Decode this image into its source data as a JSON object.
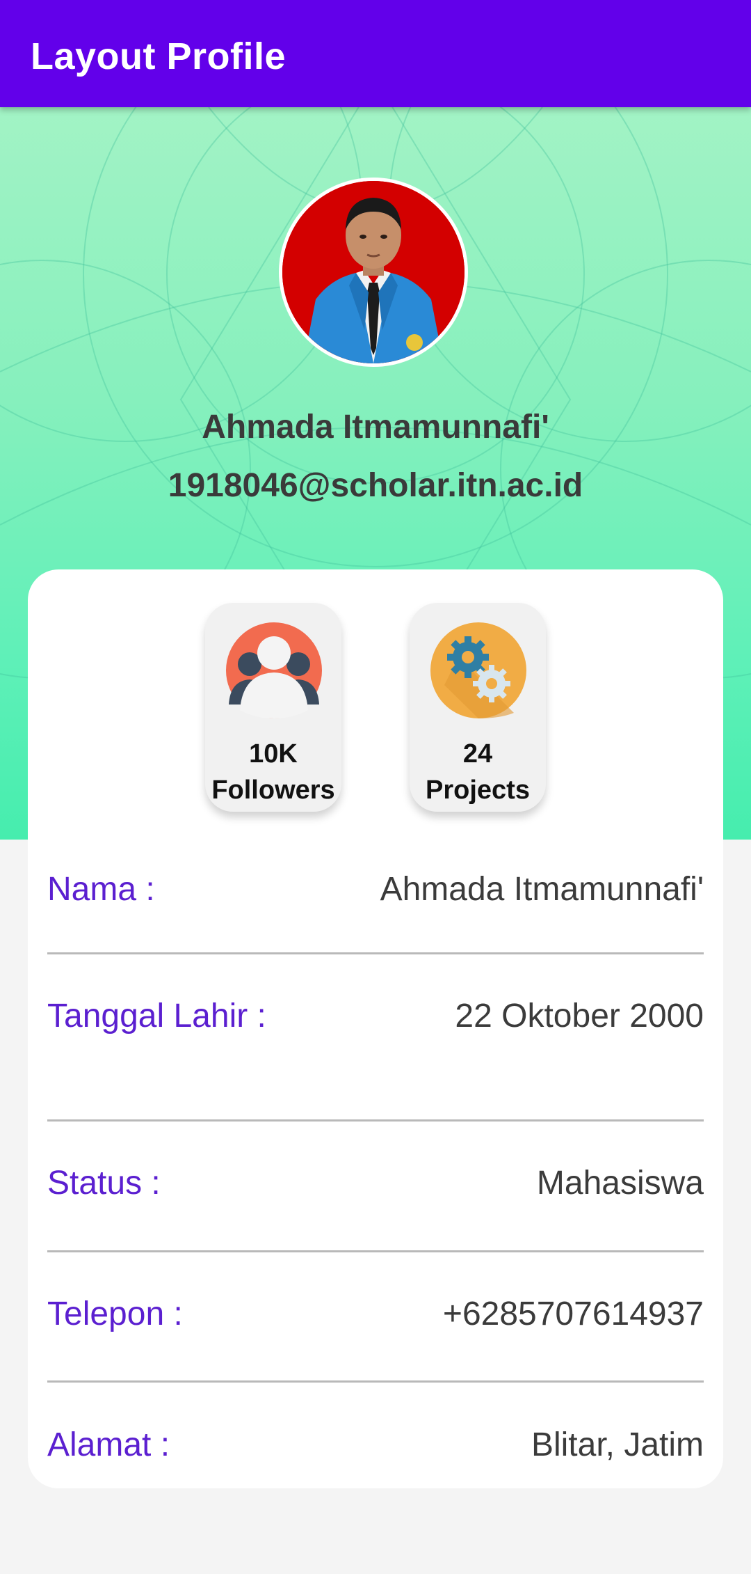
{
  "appbar": {
    "title": "Layout Profile",
    "color": "#6200ea"
  },
  "profile": {
    "name": "Ahmada Itmamunnafi'",
    "email": "1918046@scholar.itn.ac.id"
  },
  "stats": [
    {
      "icon": "followers-icon",
      "value": "10K",
      "label": "Followers"
    },
    {
      "icon": "gears-icon",
      "value": "24",
      "label": "Projects"
    }
  ],
  "details": [
    {
      "label": "Nama :",
      "value": "Ahmada Itmamunnafi'"
    },
    {
      "label": "Tanggal Lahir :",
      "value": "22 Oktober 2000"
    },
    {
      "label": "Status :",
      "value": "Mahasiswa"
    },
    {
      "label": "Telepon :",
      "value": "+6285707614937"
    },
    {
      "label": "Alamat :",
      "value": "Blitar, Jatim"
    }
  ],
  "colors": {
    "label": "#5b1fd0",
    "header_gradient_top": "#a2f3c5",
    "header_gradient_bottom": "#46edae"
  }
}
